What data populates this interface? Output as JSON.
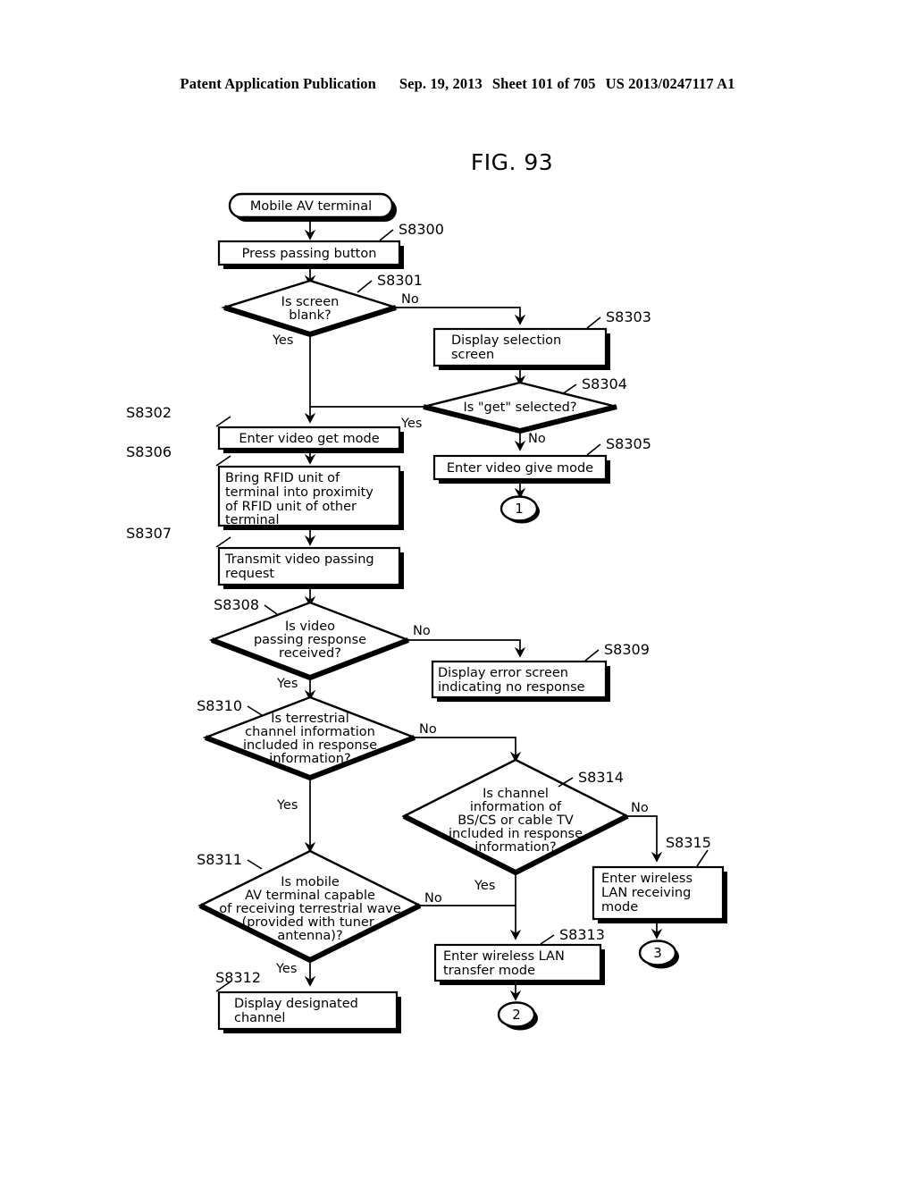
{
  "header": {
    "publication": "Patent Application Publication",
    "date": "Sep. 19, 2013",
    "sheet": "Sheet 101 of 705",
    "number": "US 2013/0247117 A1"
  },
  "figure": {
    "title": "FIG. 93"
  },
  "chart_data": {
    "type": "diagram",
    "subtype": "flowchart",
    "title": "FIG. 93",
    "nodes": [
      {
        "id": "start",
        "shape": "terminator",
        "label": "Mobile AV terminal",
        "step": ""
      },
      {
        "id": "S8300",
        "shape": "process",
        "label": "Press passing button",
        "step": "S8300"
      },
      {
        "id": "S8301",
        "shape": "decision",
        "label": "Is screen blank?",
        "step": "S8301"
      },
      {
        "id": "S8303",
        "shape": "process",
        "label": "Display selection screen",
        "step": "S8303"
      },
      {
        "id": "S8304",
        "shape": "decision",
        "label": "Is \"get\" selected?",
        "step": "S8304"
      },
      {
        "id": "S8305",
        "shape": "process",
        "label": "Enter video give mode",
        "step": "S8305"
      },
      {
        "id": "C1",
        "shape": "connector",
        "label": "1",
        "step": ""
      },
      {
        "id": "S8302",
        "shape": "process",
        "label": "Enter video get mode",
        "step": "S8302"
      },
      {
        "id": "S8306",
        "shape": "process",
        "label": "Bring RFID unit of terminal into proximity of RFID unit of other terminal",
        "step": "S8306"
      },
      {
        "id": "S8307",
        "shape": "process",
        "label": "Transmit video passing request",
        "step": "S8307"
      },
      {
        "id": "S8308",
        "shape": "decision",
        "label": "Is video passing response received?",
        "step": "S8308"
      },
      {
        "id": "S8309",
        "shape": "process",
        "label": "Display error screen indicating no response",
        "step": "S8309"
      },
      {
        "id": "S8310",
        "shape": "decision",
        "label": "Is terrestrial channel information included in response information?",
        "step": "S8310"
      },
      {
        "id": "S8314",
        "shape": "decision",
        "label": "Is channel information of BS/CS or cable TV included in response information?",
        "step": "S8314"
      },
      {
        "id": "S8315",
        "shape": "process",
        "label": "Enter wireless LAN receiving mode",
        "step": "S8315"
      },
      {
        "id": "C3",
        "shape": "connector",
        "label": "3",
        "step": ""
      },
      {
        "id": "S8311",
        "shape": "decision",
        "label": "Is mobile AV terminal capable of receiving terrestrial wave (provided with tuner, antenna)?",
        "step": "S8311"
      },
      {
        "id": "S8313",
        "shape": "process",
        "label": "Enter wireless LAN transfer mode",
        "step": "S8313"
      },
      {
        "id": "C2",
        "shape": "connector",
        "label": "2",
        "step": ""
      },
      {
        "id": "S8312",
        "shape": "process",
        "label": "Display designated channel",
        "step": "S8312"
      }
    ],
    "edges": [
      {
        "from": "start",
        "to": "S8300",
        "label": ""
      },
      {
        "from": "S8300",
        "to": "S8301",
        "label": ""
      },
      {
        "from": "S8301",
        "to": "S8302",
        "label": "Yes"
      },
      {
        "from": "S8301",
        "to": "S8303",
        "label": "No"
      },
      {
        "from": "S8303",
        "to": "S8304",
        "label": ""
      },
      {
        "from": "S8304",
        "to": "S8302",
        "label": "Yes"
      },
      {
        "from": "S8304",
        "to": "S8305",
        "label": "No"
      },
      {
        "from": "S8305",
        "to": "C1",
        "label": ""
      },
      {
        "from": "S8302",
        "to": "S8306",
        "label": ""
      },
      {
        "from": "S8306",
        "to": "S8307",
        "label": ""
      },
      {
        "from": "S8307",
        "to": "S8308",
        "label": ""
      },
      {
        "from": "S8308",
        "to": "S8310",
        "label": "Yes"
      },
      {
        "from": "S8308",
        "to": "S8309",
        "label": "No"
      },
      {
        "from": "S8310",
        "to": "S8311",
        "label": "Yes"
      },
      {
        "from": "S8310",
        "to": "S8314",
        "label": "No"
      },
      {
        "from": "S8314",
        "to": "S8313",
        "label": "Yes"
      },
      {
        "from": "S8314",
        "to": "S8315",
        "label": "No"
      },
      {
        "from": "S8315",
        "to": "C3",
        "label": ""
      },
      {
        "from": "S8311",
        "to": "S8312",
        "label": "Yes"
      },
      {
        "from": "S8311",
        "to": "S8313",
        "label": "No"
      },
      {
        "from": "S8313",
        "to": "C2",
        "label": ""
      }
    ]
  },
  "labels": {
    "start": "Mobile AV terminal",
    "s8300_step": "S8300",
    "s8300_text": "Press passing button",
    "s8301_step": "S8301",
    "s8301_l1": "Is screen",
    "s8301_l2": "blank?",
    "s8301_yes": "Yes",
    "s8301_no": "No",
    "s8303_step": "S8303",
    "s8303_l1": "Display selection",
    "s8303_l2": "screen",
    "s8304_step": "S8304",
    "s8304_text": "Is \"get\" selected?",
    "s8304_yes": "Yes",
    "s8304_no": "No",
    "s8305_step": "S8305",
    "s8305_text": "Enter video give mode",
    "conn1": "1",
    "s8302_step": "S8302",
    "s8302_text": "Enter video get mode",
    "s8306_step": "S8306",
    "s8306_l1": "Bring RFID unit of",
    "s8306_l2": "terminal into proximity",
    "s8306_l3": "of RFID unit of other",
    "s8306_l4": "terminal",
    "s8307_step": "S8307",
    "s8307_l1": "Transmit video passing",
    "s8307_l2": "request",
    "s8308_step": "S8308",
    "s8308_l1": "Is video",
    "s8308_l2": "passing response",
    "s8308_l3": "received?",
    "s8308_yes": "Yes",
    "s8308_no": "No",
    "s8309_step": "S8309",
    "s8309_l1": "Display error screen",
    "s8309_l2": "indicating no response",
    "s8310_step": "S8310",
    "s8310_l1": "Is terrestrial",
    "s8310_l2": "channel information",
    "s8310_l3": "included in response",
    "s8310_l4": "information?",
    "s8310_yes": "Yes",
    "s8310_no": "No",
    "s8314_step": "S8314",
    "s8314_l1": "Is channel",
    "s8314_l2": "information of",
    "s8314_l3": "BS/CS or cable TV",
    "s8314_l4": "included in response",
    "s8314_l5": "information?",
    "s8314_yes": "Yes",
    "s8314_no": "No",
    "s8315_step": "S8315",
    "s8315_l1": "Enter wireless",
    "s8315_l2": "LAN receiving",
    "s8315_l3": "mode",
    "conn3": "3",
    "s8311_step": "S8311",
    "s8311_l1": "Is mobile",
    "s8311_l2": "AV terminal capable",
    "s8311_l3": "of receiving terrestrial wave",
    "s8311_l4": "(provided with tuner,",
    "s8311_l5": "antenna)?",
    "s8311_yes": "Yes",
    "s8311_no": "No",
    "s8313_step": "S8313",
    "s8313_l1": "Enter wireless LAN",
    "s8313_l2": "transfer mode",
    "conn2": "2",
    "s8312_step": "S8312",
    "s8312_l1": "Display designated",
    "s8312_l2": "channel"
  }
}
